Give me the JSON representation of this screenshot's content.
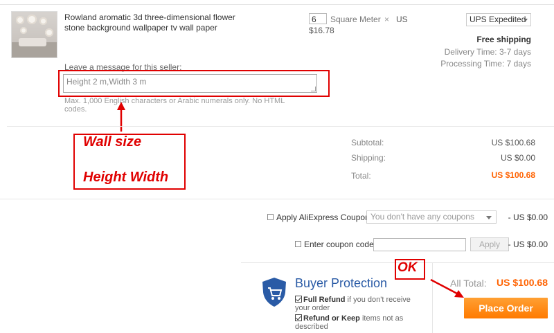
{
  "item": {
    "image_icon": "wallpaper-thumbnail",
    "title": "Rowland aromatic 3d three-dimensional flower stone background wallpaper tv wall paper",
    "quantity": "6",
    "unit": "Square Meter",
    "times_sign": "×",
    "currency": "US",
    "unit_price": "$16.78",
    "shipping_method": "UPS Expedited",
    "free_shipping": "Free shipping",
    "delivery_time": "Delivery Time:  3-7 days",
    "processing_time": "Processing Time:  7 days"
  },
  "message": {
    "label": "Leave a message for this seller:",
    "value": "Height 2 m,Width 3 m",
    "note": "Max. 1,000 English characters or Arabic numerals only. No HTML codes."
  },
  "annotations": {
    "line1": "Wall size",
    "line2": "Height Width",
    "ok": "OK",
    "color": "#e00000"
  },
  "summary": {
    "subtotal_label": "Subtotal:",
    "subtotal_value": "US $100.68",
    "shipping_label": "Shipping:",
    "shipping_value": "US $0.00",
    "total_label": "Total:",
    "total_value": "US $100.68"
  },
  "coupons": {
    "aliexpress_label": "Apply AliExpress Coupon:",
    "aliexpress_placeholder": "You don't have any coupons",
    "aliexpress_discount": "- US $0.00",
    "code_label": "Enter coupon code:",
    "apply_button": "Apply",
    "code_discount": "- US $0.00"
  },
  "buyer_protection": {
    "icon": "shield-cart-icon",
    "title": "Buyer Protection",
    "item1_bold": "Full Refund",
    "item1_rest": " if you don't receive your order",
    "item2_bold": "Refund or Keep",
    "item2_rest": " items not as described"
  },
  "order": {
    "all_total_label": "All Total:",
    "all_total_value": "US $100.68",
    "place_order": "Place Order",
    "accent_color": "#ff6200"
  }
}
